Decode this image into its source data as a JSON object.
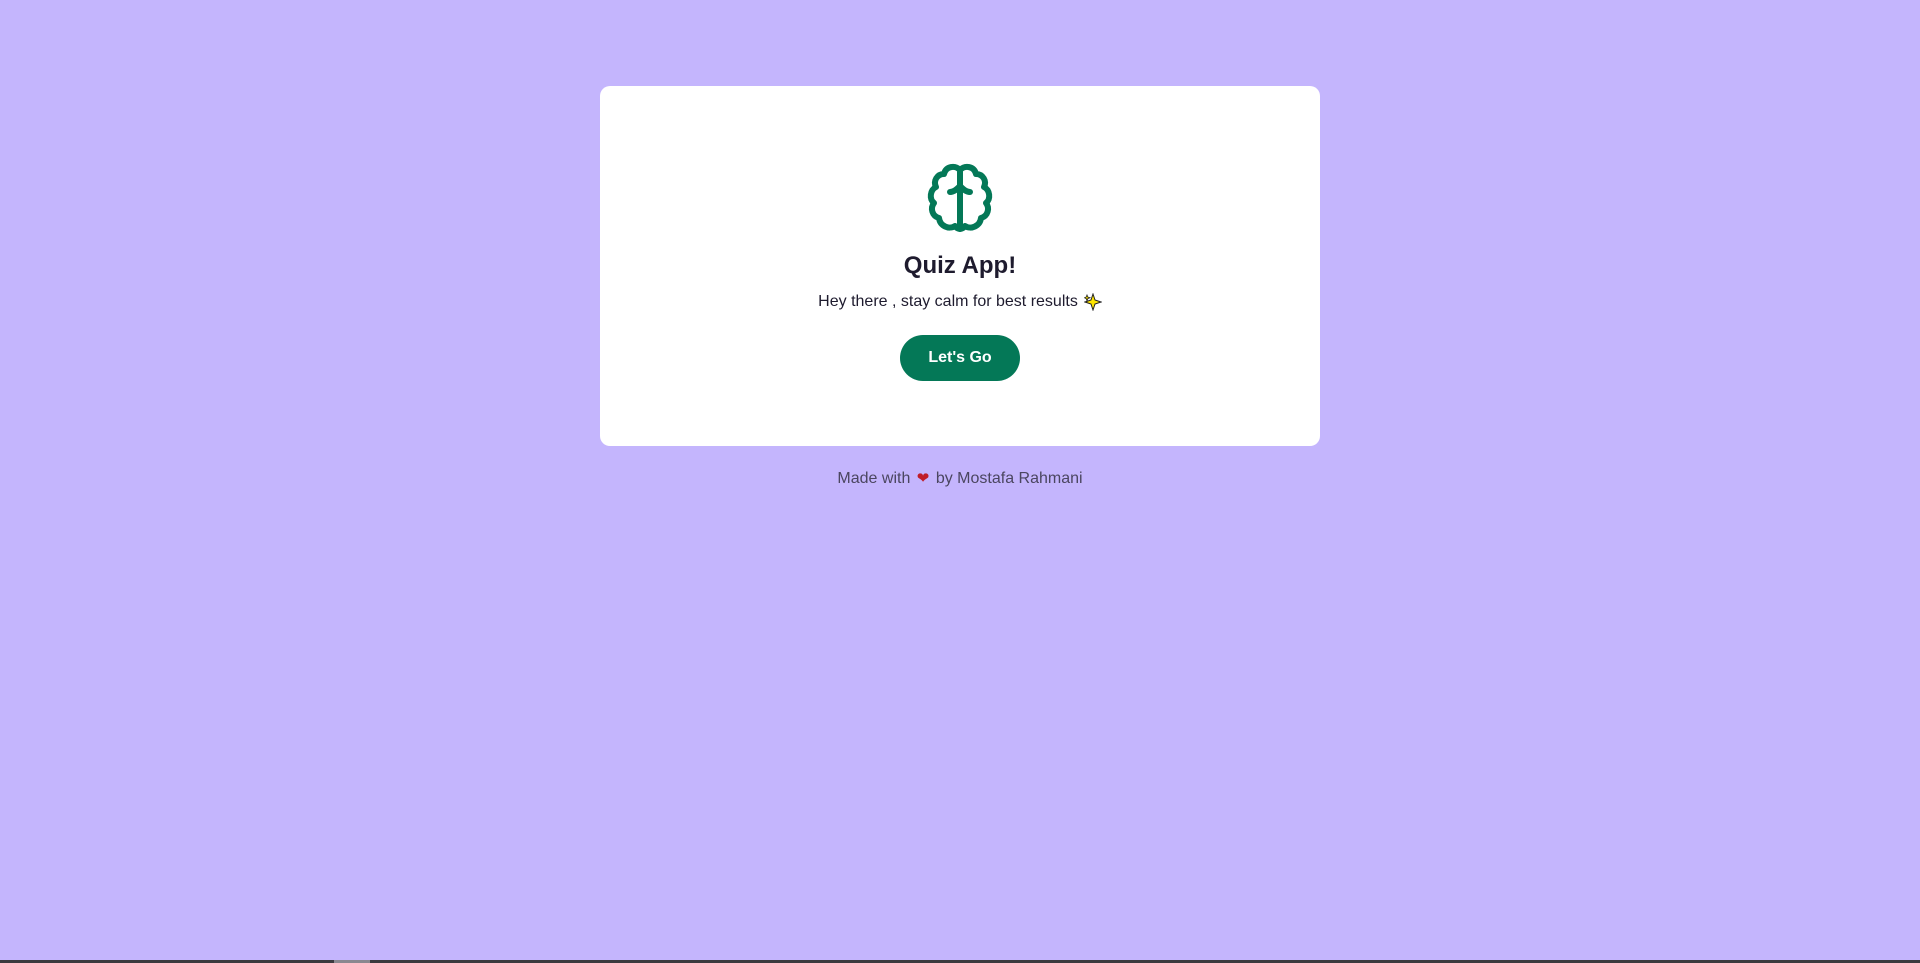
{
  "colors": {
    "background": "#c4b5fd",
    "card": "#ffffff",
    "accent": "#047857",
    "heart": "#c01c28"
  },
  "card": {
    "icon": "brain-icon",
    "title": "Quiz App!",
    "subtitle": "Hey there , stay calm for best results",
    "subtitle_icon": "sparkle-icon",
    "button_label": "Let's Go"
  },
  "footer": {
    "prefix": "Made with",
    "icon": "heart-icon",
    "heart_glyph": "❤",
    "suffix": "by Mostafa Rahmani"
  }
}
